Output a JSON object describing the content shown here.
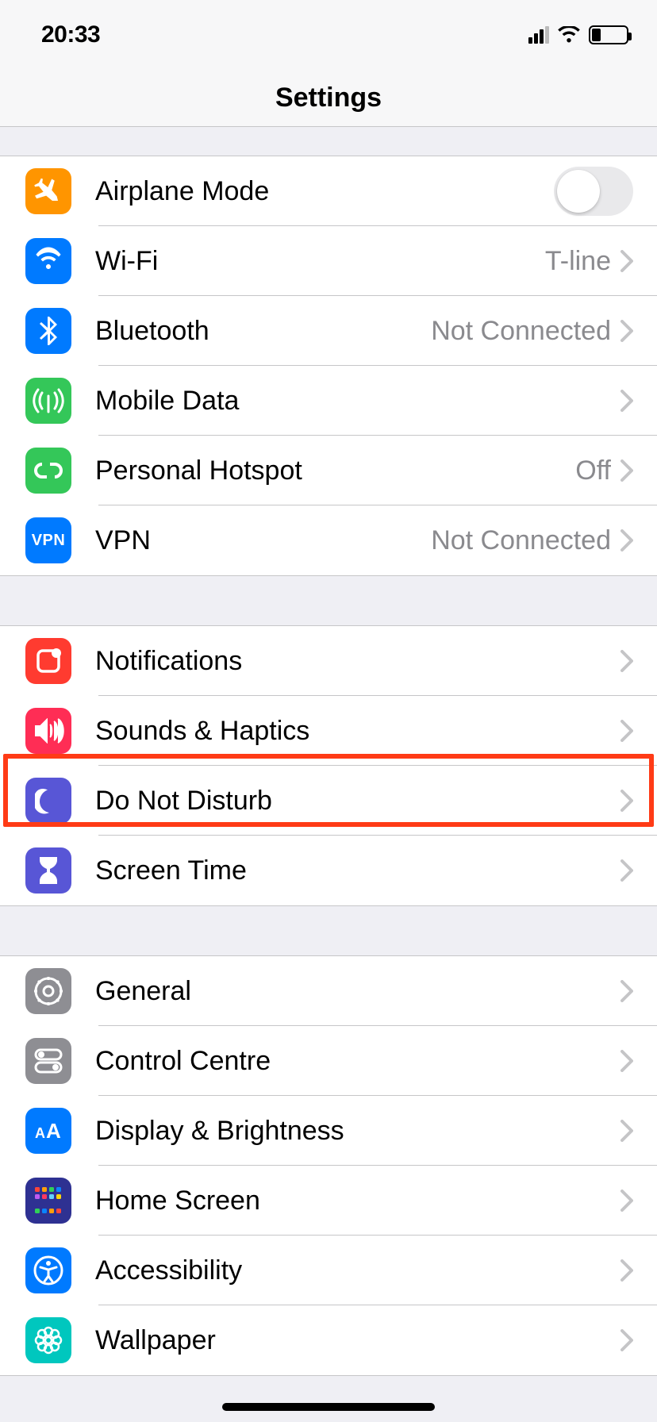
{
  "status": {
    "time": "20:33"
  },
  "header": {
    "title": "Settings"
  },
  "groups": [
    {
      "items": [
        {
          "id": "airplane",
          "label": "Airplane Mode",
          "value": null,
          "toggle": false,
          "icon_bg": "#ff9500"
        },
        {
          "id": "wifi",
          "label": "Wi-Fi",
          "value": "T-line",
          "icon_bg": "#007aff"
        },
        {
          "id": "bluetooth",
          "label": "Bluetooth",
          "value": "Not Connected",
          "icon_bg": "#007aff"
        },
        {
          "id": "mobiledata",
          "label": "Mobile Data",
          "value": null,
          "icon_bg": "#34c759"
        },
        {
          "id": "hotspot",
          "label": "Personal Hotspot",
          "value": "Off",
          "icon_bg": "#34c759"
        },
        {
          "id": "vpn",
          "label": "VPN",
          "value": "Not Connected",
          "icon_bg": "#007aff"
        }
      ]
    },
    {
      "items": [
        {
          "id": "notifications",
          "label": "Notifications",
          "icon_bg": "#ff3b30"
        },
        {
          "id": "sounds",
          "label": "Sounds & Haptics",
          "icon_bg": "#ff2d55"
        },
        {
          "id": "dnd",
          "label": "Do Not Disturb",
          "icon_bg": "#5856d6"
        },
        {
          "id": "screentime",
          "label": "Screen Time",
          "icon_bg": "#5856d6",
          "highlighted": true
        }
      ]
    },
    {
      "items": [
        {
          "id": "general",
          "label": "General",
          "icon_bg": "#8e8e93"
        },
        {
          "id": "controlcentre",
          "label": "Control Centre",
          "icon_bg": "#8e8e93"
        },
        {
          "id": "display",
          "label": "Display & Brightness",
          "icon_bg": "#007aff"
        },
        {
          "id": "homescreen",
          "label": "Home Screen",
          "icon_bg": "#2e3192"
        },
        {
          "id": "accessibility",
          "label": "Accessibility",
          "icon_bg": "#007aff"
        },
        {
          "id": "wallpaper",
          "label": "Wallpaper",
          "icon_bg": "#00c7be"
        }
      ]
    }
  ]
}
